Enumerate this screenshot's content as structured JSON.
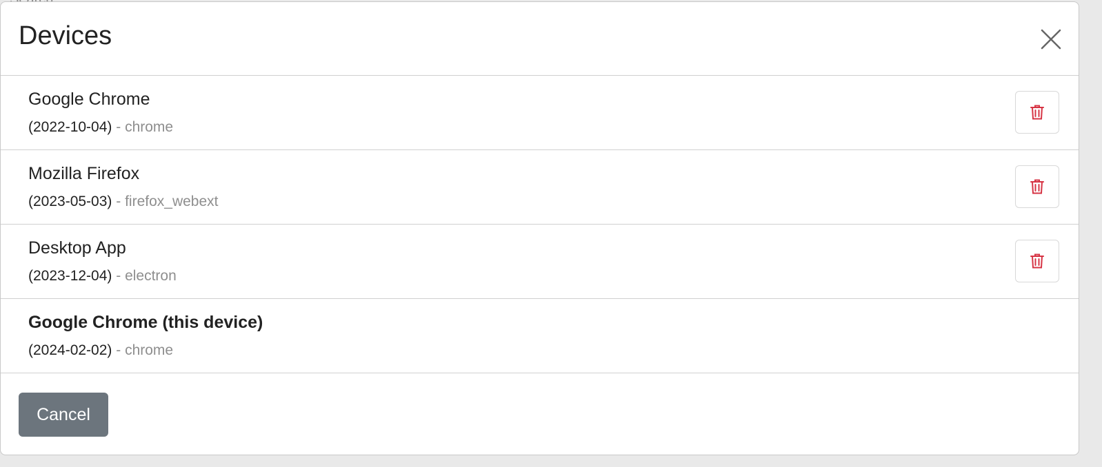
{
  "background": {
    "partial_text": "Search"
  },
  "modal": {
    "title": "Devices",
    "cancel_label": "Cancel"
  },
  "devices": [
    {
      "name": "Google Chrome",
      "date": "(2022-10-04)",
      "separator": " - ",
      "type": "chrome",
      "current": false
    },
    {
      "name": "Mozilla Firefox",
      "date": "(2023-05-03)",
      "separator": " - ",
      "type": "firefox_webext",
      "current": false
    },
    {
      "name": "Desktop App",
      "date": "(2023-12-04)",
      "separator": " - ",
      "type": "electron",
      "current": false
    },
    {
      "name": "Google Chrome (this device)",
      "date": "(2024-02-02)",
      "separator": " - ",
      "type": "chrome",
      "current": true
    }
  ],
  "colors": {
    "delete_icon": "#d63343",
    "cancel_bg": "#6c757d",
    "muted_text": "#8e8e8e"
  },
  "icons": {
    "close": "close-icon",
    "delete": "trash-icon"
  }
}
